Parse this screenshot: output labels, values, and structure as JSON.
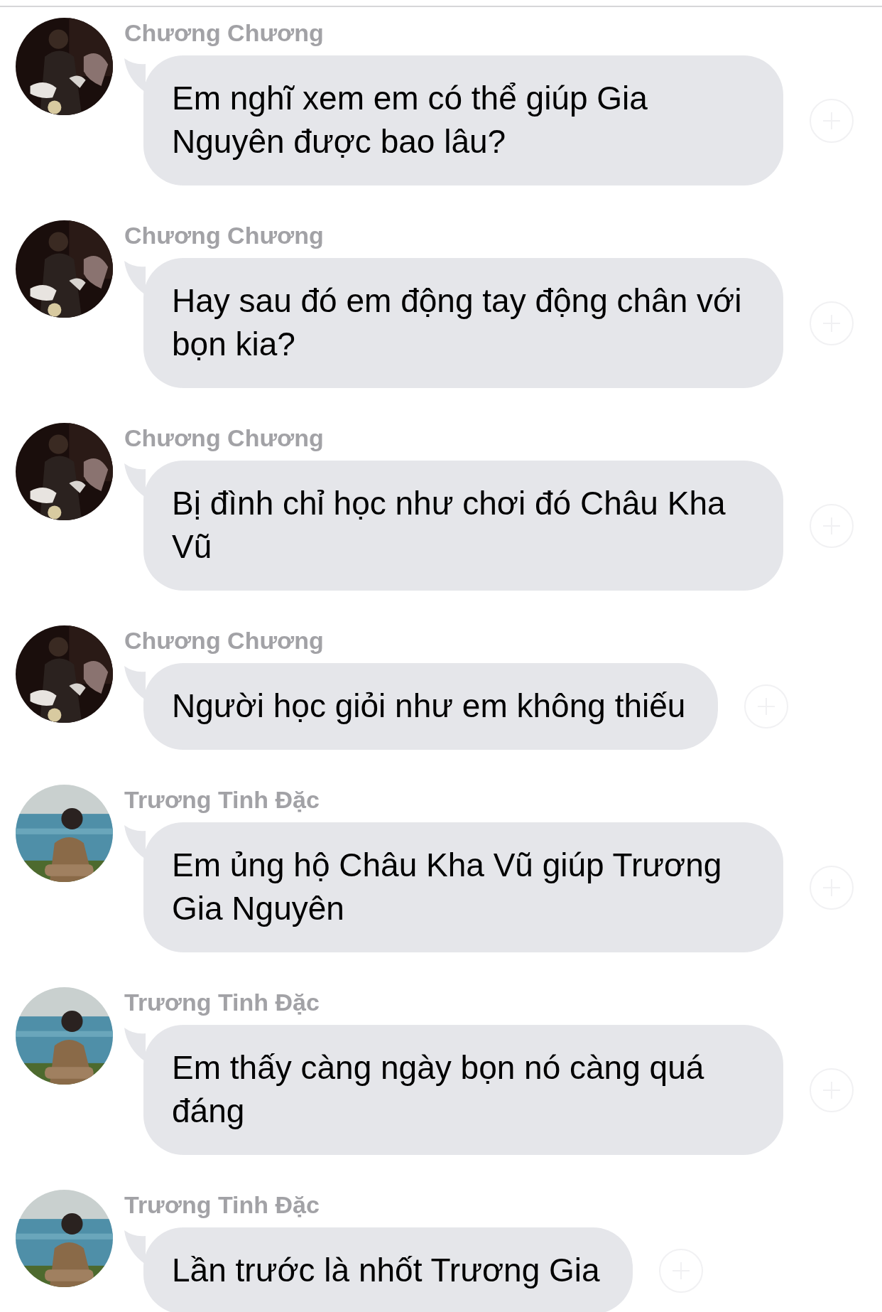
{
  "messages": [
    {
      "sender": "Chương Chương",
      "text": "Em nghĩ xem em có thể giúp Gia Nguyên được bao lâu?"
    },
    {
      "sender": "Chương Chương",
      "text": "Hay sau đó em động tay động chân với bọn kia?"
    },
    {
      "sender": "Chương Chương",
      "text": "Bị đình chỉ học như chơi đó Châu Kha Vũ"
    },
    {
      "sender": "Chương Chương",
      "text": "Người học giỏi như em không thiếu"
    },
    {
      "sender": "Trương Tinh Đặc",
      "text": "Em ủng hộ Châu Kha Vũ giúp Trương Gia Nguyên"
    },
    {
      "sender": "Trương Tinh Đặc",
      "text": "Em thấy càng ngày bọn nó càng quá đáng"
    },
    {
      "sender": "Trương Tinh Đặc",
      "text": "Lần trước là nhốt Trương Gia"
    }
  ]
}
